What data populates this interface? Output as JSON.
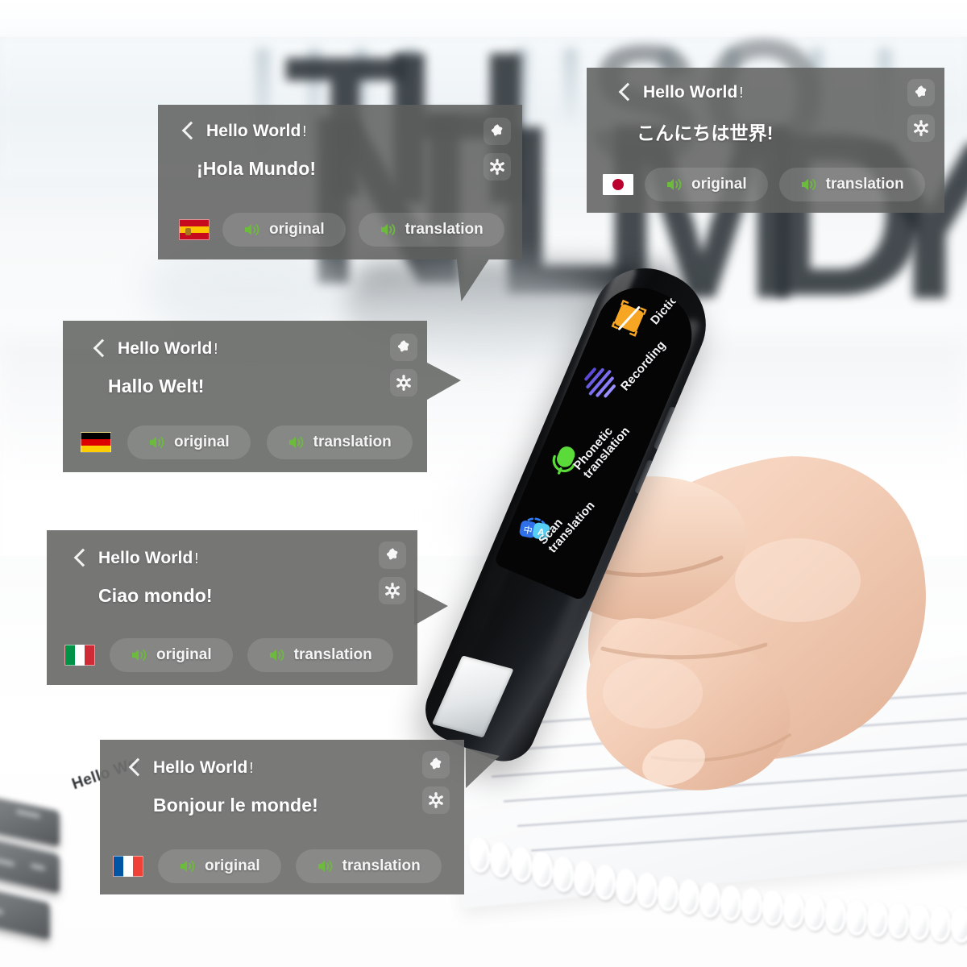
{
  "scene": {
    "background_description": "blurred office interior with large dark letters",
    "background_letters": [
      "N",
      "L",
      "M",
      "D",
      "Y"
    ],
    "notebook_text": "Hello Wo",
    "colors": {
      "card_background": "#5e605e",
      "speaker_green": "#6cbb3c",
      "pen_body": "#0b0c0e",
      "screen_black": "#050506"
    }
  },
  "cards": [
    {
      "id": "spanish",
      "language": "Spanish",
      "flag": "flag-spain",
      "back_icon": "chevron-left-icon",
      "source_text": "Hello World",
      "source_punct": "!",
      "translated_text": "¡Hola Mundo!",
      "favorite_icon": "star-icon",
      "settings_icon": "gear-icon",
      "buttons": [
        {
          "label": "original",
          "icon": "speaker-icon"
        },
        {
          "label": "translation",
          "icon": "speaker-icon"
        }
      ]
    },
    {
      "id": "japanese",
      "language": "Japanese",
      "flag": "flag-japan",
      "back_icon": "chevron-left-icon",
      "source_text": "Hello World",
      "source_punct": "!",
      "translated_text": "こんにちは世界!",
      "favorite_icon": "star-icon",
      "settings_icon": "gear-icon",
      "buttons": [
        {
          "label": "original",
          "icon": "speaker-icon"
        },
        {
          "label": "translation",
          "icon": "speaker-icon"
        }
      ]
    },
    {
      "id": "german",
      "language": "German",
      "flag": "flag-germany",
      "back_icon": "chevron-left-icon",
      "source_text": "Hello World",
      "source_punct": "!",
      "translated_text": "Hallo Welt!",
      "favorite_icon": "star-icon",
      "settings_icon": "gear-icon",
      "buttons": [
        {
          "label": "original",
          "icon": "speaker-icon"
        },
        {
          "label": "translation",
          "icon": "speaker-icon"
        }
      ]
    },
    {
      "id": "italian",
      "language": "Italian",
      "flag": "flag-italy",
      "back_icon": "chevron-left-icon",
      "source_text": "Hello World",
      "source_punct": "!",
      "translated_text": "Ciao mondo!",
      "favorite_icon": "star-icon",
      "settings_icon": "gear-icon",
      "buttons": [
        {
          "label": "original",
          "icon": "speaker-icon"
        },
        {
          "label": "translation",
          "icon": "speaker-icon"
        }
      ]
    },
    {
      "id": "french",
      "language": "French",
      "flag": "flag-france",
      "back_icon": "chevron-left-icon",
      "source_text": "Hello World",
      "source_punct": "!",
      "translated_text": "Bonjour le monde!",
      "favorite_icon": "star-icon",
      "settings_icon": "gear-icon",
      "buttons": [
        {
          "label": "original",
          "icon": "speaker-icon"
        },
        {
          "label": "translation",
          "icon": "speaker-icon"
        }
      ]
    }
  ],
  "device": {
    "name": "translation-scanner-pen",
    "menu": [
      {
        "id": "dictionary",
        "label": "Dictionary",
        "icon": "dictionary-icon",
        "icon_color": "#f5a623"
      },
      {
        "id": "recording",
        "label": "Recording",
        "icon": "waveform-icon",
        "icon_color": "#6a5ce0"
      },
      {
        "id": "phonetic-translation",
        "label": "Phonetic\ntranslation",
        "icon": "microphone-icon",
        "icon_color": "#5bdb3a"
      },
      {
        "id": "scan-translation",
        "label": "Scan\ntranslation",
        "icon": "scan-translate-icon",
        "icon_color": "#2f7df6",
        "glyphs": [
          "中",
          "A"
        ]
      }
    ]
  }
}
